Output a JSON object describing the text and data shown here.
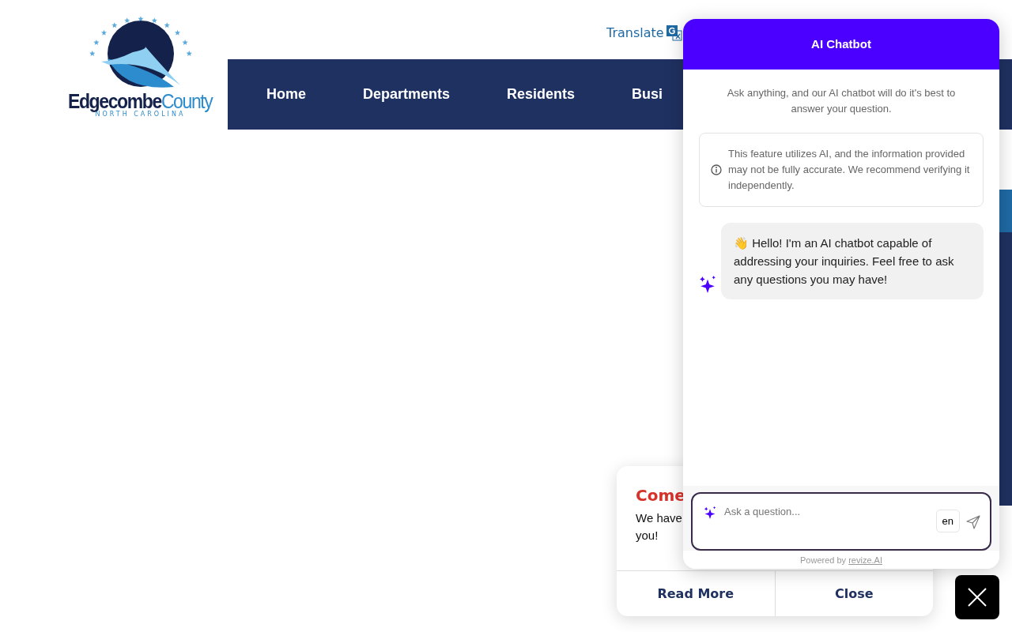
{
  "logo": {
    "name_bold": "Edgecombe",
    "name_light": "County",
    "subtitle": "NORTH CAROLINA"
  },
  "translate": {
    "label": "Translate"
  },
  "nav": [
    {
      "label": "Home"
    },
    {
      "label": "Departments"
    },
    {
      "label": "Residents"
    },
    {
      "label": "Busi"
    }
  ],
  "popup": {
    "title": "Come",
    "lines": [
      "We have",
      "you!"
    ],
    "buttons": [
      "Read More",
      "Close"
    ]
  },
  "chatbot": {
    "title": "AI Chatbot",
    "intro": "Ask anything, and our AI chatbot will do it's best to answer your question.",
    "notice": "This feature utilizes AI, and the information provided may not be fully accurate. We recommend verifying it independently.",
    "messages": [
      {
        "text": "👋 Hello! I'm an AI chatbot capable of addressing your inquiries. Feel free to ask any questions you may have!"
      }
    ],
    "input": {
      "placeholder": "Ask a question...",
      "language": "en"
    },
    "powered_by": "Powered by",
    "powered_link": "revize.AI"
  }
}
